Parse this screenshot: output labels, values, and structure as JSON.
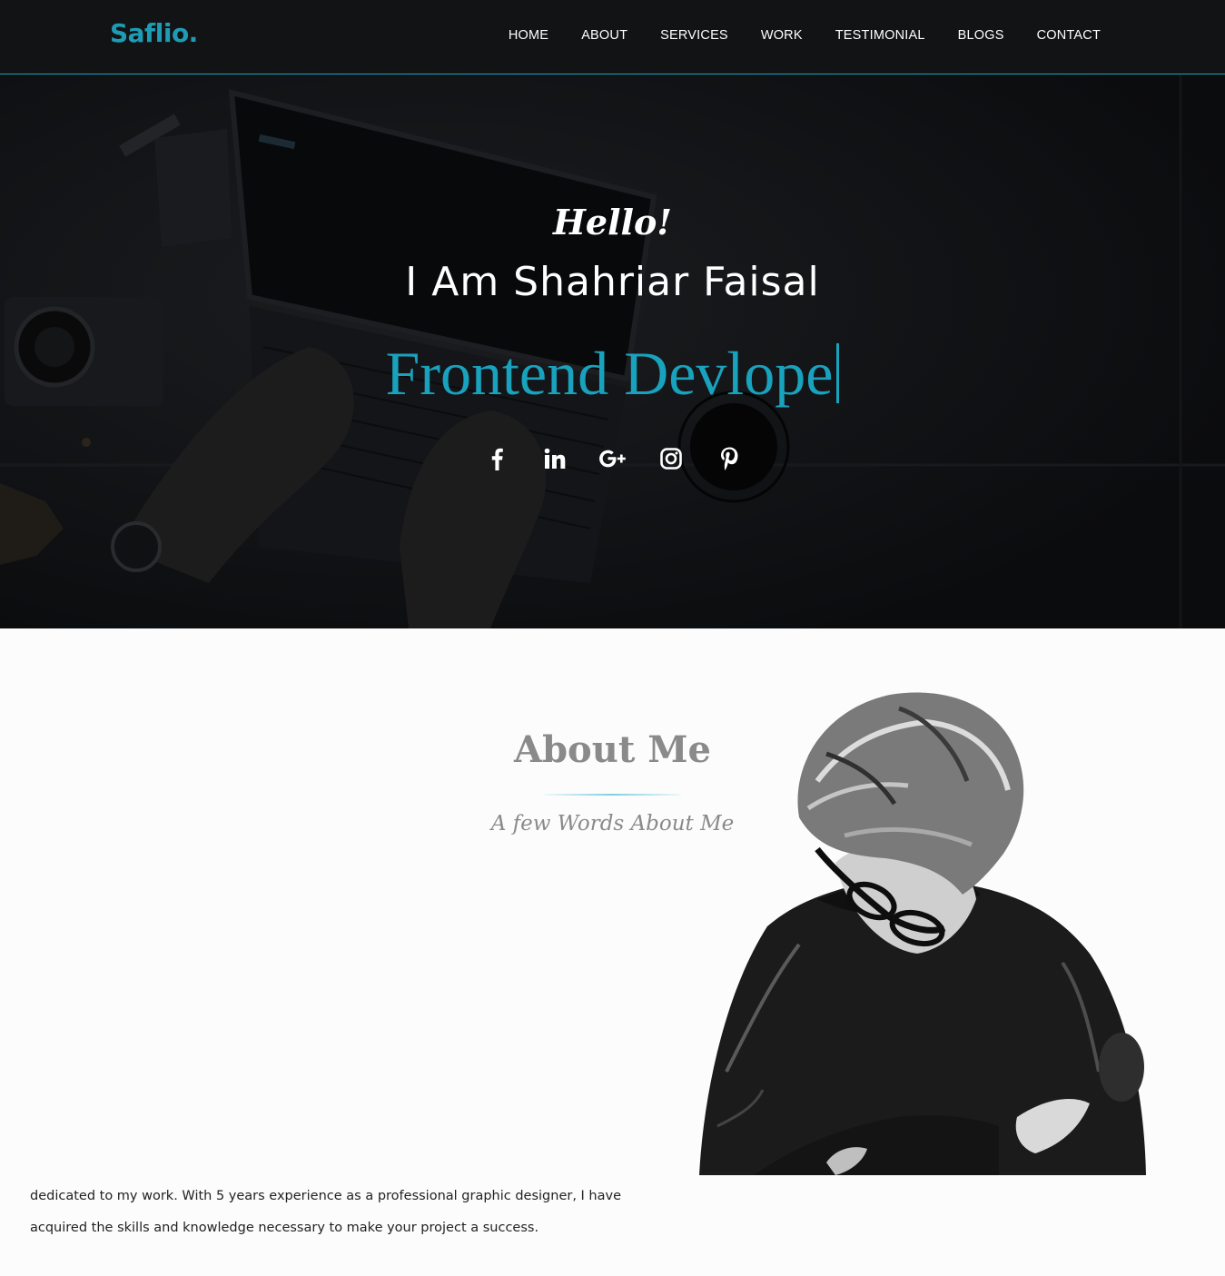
{
  "brand": {
    "logo": "Saflio."
  },
  "nav": {
    "items": [
      {
        "label": "HOME"
      },
      {
        "label": "ABOUT"
      },
      {
        "label": "SERVICES"
      },
      {
        "label": "WORK"
      },
      {
        "label": "TESTIMONIAL"
      },
      {
        "label": "BLOGS"
      },
      {
        "label": "CONTACT"
      }
    ]
  },
  "hero": {
    "greeting": "Hello!",
    "name": "I Am Shahriar Faisal",
    "role": "Frontend Devlope",
    "socials": [
      {
        "icon": "facebook-icon"
      },
      {
        "icon": "linkedin-icon"
      },
      {
        "icon": "google-plus-icon"
      },
      {
        "icon": "instagram-icon"
      },
      {
        "icon": "pinterest-icon"
      }
    ]
  },
  "about": {
    "title": "About Me",
    "subtitle": "A few Words About Me",
    "text_line1": "dedicated to my work. With 5 years experience as a professional graphic designer, I have",
    "text_line2": "acquired the skills and knowledge necessary to make your project a success."
  },
  "colors": {
    "accent": "#1aa3c0",
    "nav_bg": "#121314",
    "hero_bg": "#0c0d0f",
    "heading_gray": "#8a8a8a"
  }
}
